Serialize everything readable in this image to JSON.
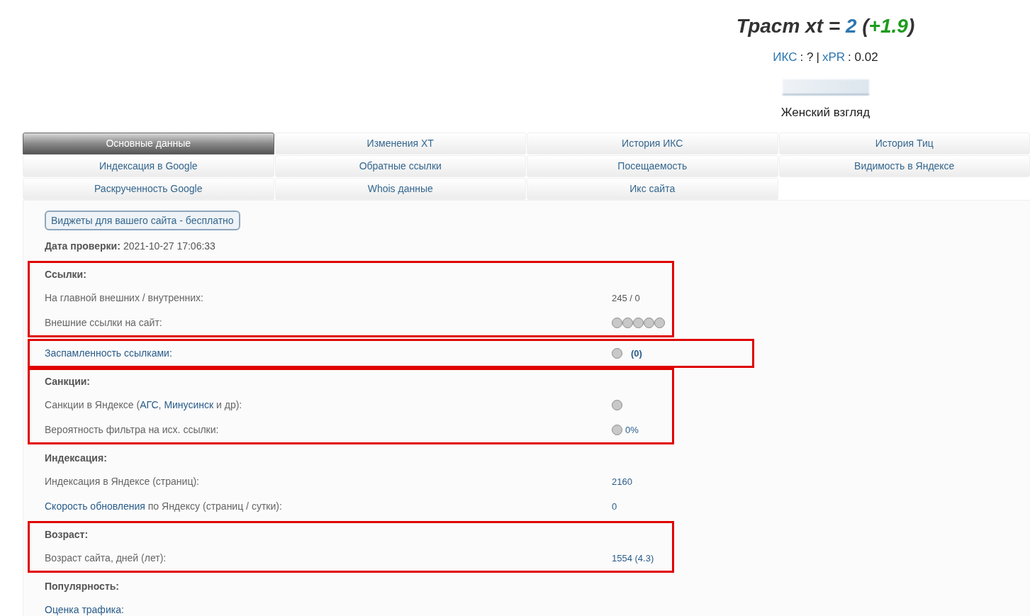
{
  "header": {
    "title": {
      "prefix": "Траст xt = ",
      "value": "2",
      "change_open": " (",
      "change": "+1.9",
      "change_close": ")"
    },
    "metrics": [
      {
        "label": "ИКС",
        "colon": ":",
        "value": "?"
      },
      {
        "label": "xPR",
        "colon": ":",
        "value": "0.02"
      }
    ],
    "separator": "|",
    "site_name": "Женский взгляд"
  },
  "tabs": [
    {
      "label": "Основные данные",
      "selected": true
    },
    {
      "label": "Изменения XT",
      "selected": false
    },
    {
      "label": "История ИКС",
      "selected": false
    },
    {
      "label": "История Тиц",
      "selected": false
    },
    {
      "label": "Индексация в Google",
      "selected": false
    },
    {
      "label": "Обратные ссылки",
      "selected": false
    },
    {
      "label": "Посещаемость",
      "selected": false
    },
    {
      "label": "Видимость в Яндексе",
      "selected": false
    },
    {
      "label": "Раскрученность Google",
      "selected": false
    },
    {
      "label": "Whois данные",
      "selected": false
    },
    {
      "label": "Икс сайта",
      "selected": false
    }
  ],
  "widget_button": "Виджеты для вашего сайта - бесплатно",
  "check_date": {
    "label": "Дата проверки:",
    "value": "2021-10-27 17:06:33"
  },
  "blocks": [
    {
      "heading": "Ссылки:",
      "highlighted": true,
      "wide": false,
      "rows": [
        {
          "label": [
            {
              "text": "На главной внешних / внутренних:",
              "link": false
            }
          ],
          "kind": "text",
          "value": "245 / 0",
          "dots": []
        },
        {
          "label": [
            {
              "text": "Внешние ссылки на сайт:",
              "link": false
            }
          ],
          "kind": "dots",
          "dots": [
            {
              "color": "#c8c8c8"
            },
            {
              "color": "#c8c8c8"
            },
            {
              "color": "#c8c8c8"
            },
            {
              "color": "#c8c8c8"
            },
            {
              "color": "#c8c8c8"
            }
          ]
        }
      ]
    },
    {
      "highlighted": true,
      "wide": true,
      "rows": [
        {
          "label": [
            {
              "text": "Заспамленность ссылками:",
              "link": true
            }
          ],
          "kind": "dot-count",
          "value": "(0)",
          "dots": [
            {
              "color": "#c8c8c8"
            }
          ]
        }
      ]
    },
    {
      "heading": "Санкции:",
      "highlighted": true,
      "wide": false,
      "rows": [
        {
          "label": [
            {
              "text": "Санкции в Яндексе (",
              "link": false
            },
            {
              "text": "АГС",
              "link": true
            },
            {
              "text": ", ",
              "link": false
            },
            {
              "text": "Минусинск",
              "link": true
            },
            {
              "text": " и др):",
              "link": false
            }
          ],
          "kind": "dots",
          "dots": [
            {
              "color": "#c8c8c8"
            }
          ]
        },
        {
          "label": [
            {
              "text": "Вероятность фильтра на исх. ссылки:",
              "link": false
            }
          ],
          "kind": "dot-link",
          "value": "0%",
          "dots": [
            {
              "color": "#c8c8c8"
            }
          ]
        }
      ]
    },
    {
      "heading": "Индексация:",
      "highlighted": false,
      "wide": false,
      "rows": [
        {
          "label": [
            {
              "text": "Индексация в Яндексе (страниц):",
              "link": false
            }
          ],
          "kind": "link",
          "value": "2160",
          "dots": []
        },
        {
          "label": [
            {
              "text": "Скорость обновления",
              "link": true
            },
            {
              "text": " по Яндексу (страниц / сутки):",
              "link": false
            }
          ],
          "kind": "link",
          "value": "0",
          "dots": []
        }
      ]
    },
    {
      "heading": "Возраст:",
      "highlighted": true,
      "wide": false,
      "rows": [
        {
          "label": [
            {
              "text": "Возраст сайта, дней (лет):",
              "link": false
            }
          ],
          "kind": "link",
          "value": "1554 (4.3)",
          "dots": []
        }
      ]
    },
    {
      "heading": "Популярность:",
      "highlighted": false,
      "wide": false,
      "rows": [
        {
          "label": [
            {
              "text": "Оценка трафика:",
              "link": true
            }
          ],
          "kind": "none",
          "dots": []
        }
      ]
    }
  ]
}
